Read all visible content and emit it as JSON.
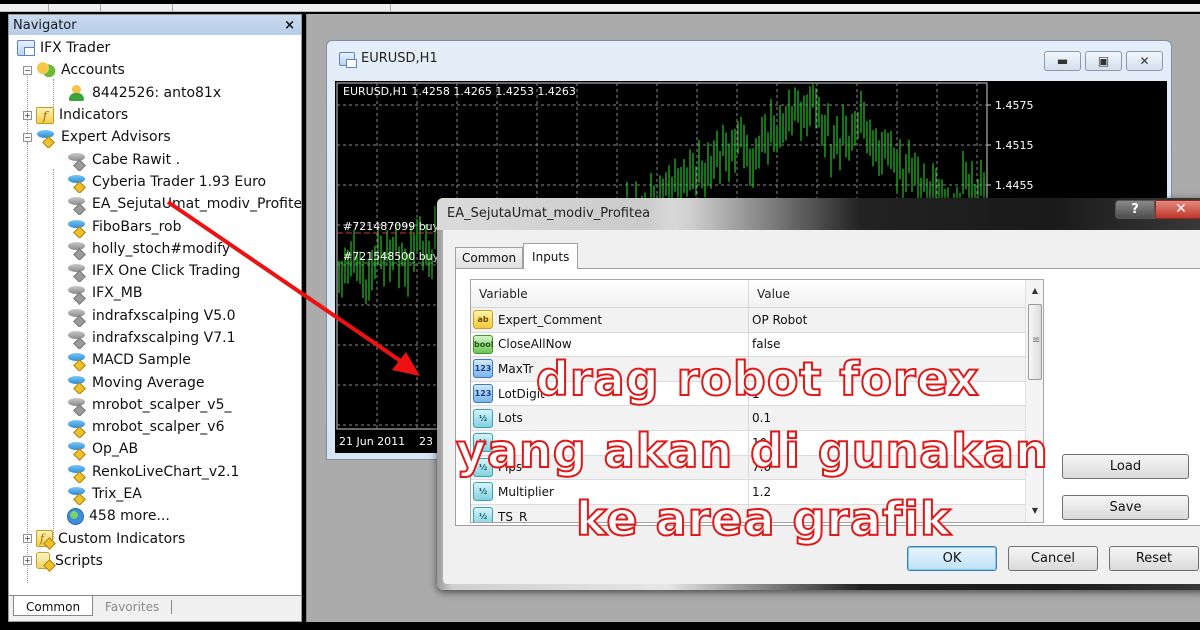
{
  "navigator": {
    "title": "Navigator",
    "close_icon": "×",
    "root": {
      "label": "IFX Trader",
      "icon": "terminal-icon"
    },
    "accounts": {
      "label": "Accounts",
      "expanded": true,
      "items": [
        {
          "label": "8442526: anto81x",
          "icon": "user-icon"
        }
      ]
    },
    "indicators": {
      "label": "Indicators",
      "expanded": false
    },
    "expert_advisors": {
      "label": "Expert Advisors",
      "expanded": true,
      "items": [
        {
          "label": "Cabe Rawit .",
          "icon": "ea-gray"
        },
        {
          "label": "Cyberia Trader 1.93 Euro",
          "icon": "ea-blue"
        },
        {
          "label": "EA_SejutaUmat_modiv_Profitea",
          "icon": "ea-gray"
        },
        {
          "label": "FiboBars_rob",
          "icon": "ea-blue"
        },
        {
          "label": "holly_stoch#modify",
          "icon": "ea-gray"
        },
        {
          "label": "IFX One Click Trading",
          "icon": "ea-gray"
        },
        {
          "label": "IFX_MB",
          "icon": "ea-gray"
        },
        {
          "label": "indrafxscalping V5.0",
          "icon": "ea-gray"
        },
        {
          "label": "indrafxscalping V7.1",
          "icon": "ea-gray"
        },
        {
          "label": "MACD Sample",
          "icon": "ea-blue"
        },
        {
          "label": "Moving Average",
          "icon": "ea-blue"
        },
        {
          "label": "mrobot_scalper_v5_",
          "icon": "ea-gray"
        },
        {
          "label": "mrobot_scalper_v6",
          "icon": "ea-blue"
        },
        {
          "label": "Op_AB",
          "icon": "ea-blue"
        },
        {
          "label": "RenkoLiveChart_v2.1",
          "icon": "ea-blue"
        },
        {
          "label": "Trix_EA",
          "icon": "ea-blue"
        },
        {
          "label": "458 more...",
          "icon": "globe"
        }
      ]
    },
    "custom_indicators": {
      "label": "Custom Indicators",
      "expanded": false
    },
    "scripts": {
      "label": "Scripts",
      "expanded": false
    },
    "tabs": [
      {
        "label": "Common",
        "active": true
      },
      {
        "label": "Favorites",
        "active": false
      }
    ]
  },
  "chart_window": {
    "title": "EURUSD,H1",
    "ohlc_label": "EURUSD,H1  1.4258 1.4265 1.4253 1.4263",
    "price_ticks": [
      "1.4575",
      "1.4515",
      "1.4455"
    ],
    "time_ticks": [
      "21 Jun 2011",
      "23"
    ],
    "orders": [
      {
        "label": "#721487099 buy"
      },
      {
        "label": "#721548500 buy"
      }
    ],
    "bar_color": "#22c322",
    "grid_color": "#8a8a8a"
  },
  "ea_dialog": {
    "title": "EA_SejutaUmat_modiv_Profitea",
    "help_label": "?",
    "close_label": "✕",
    "tabs": [
      {
        "label": "Common",
        "active": false
      },
      {
        "label": "Inputs",
        "active": true
      }
    ],
    "columns": {
      "variable": "Variable",
      "value": "Value"
    },
    "rows": [
      {
        "type": "ab",
        "variable": "Expert_Comment",
        "value": "OP Robot"
      },
      {
        "type": "bool",
        "variable": "CloseAllNow",
        "value": "false"
      },
      {
        "type": "123",
        "variable": "MaxTr",
        "value": ""
      },
      {
        "type": "123",
        "variable": "LotDigit",
        "value": "1"
      },
      {
        "type": "½",
        "variable": "Lots",
        "value": "0.1"
      },
      {
        "type": "½",
        "variable": "",
        "value": "10"
      },
      {
        "type": "½",
        "variable": "Pips",
        "value": "7.0"
      },
      {
        "type": "½",
        "variable": "Multiplier",
        "value": "1.2"
      },
      {
        "type": "½",
        "variable": "TS_R",
        "value": ""
      }
    ],
    "buttons": {
      "load": "Load",
      "save": "Save",
      "ok": "OK",
      "cancel": "Cancel",
      "reset": "Reset"
    }
  },
  "annotation": {
    "line1": "drag robot forex",
    "line2": "yang akan di gunakan",
    "line3": "ke area grafik",
    "color": "#e01818"
  }
}
